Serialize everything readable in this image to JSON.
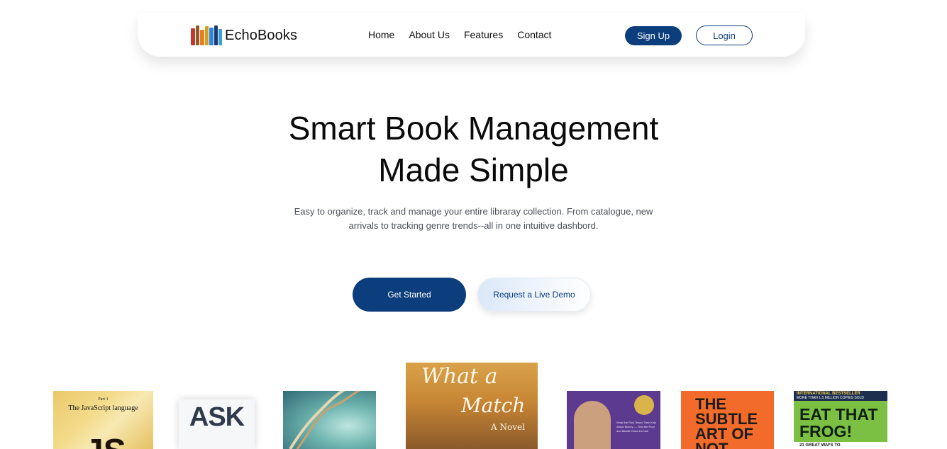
{
  "brand": {
    "name": "EchoBooks"
  },
  "nav": {
    "links": [
      "Home",
      "About Us",
      "Features",
      "Contact"
    ]
  },
  "auth": {
    "signup_label": "Sign Up",
    "login_label": "Login"
  },
  "hero": {
    "title_line1": "Smart Book Management",
    "title_line2": "Made Simple",
    "subtitle_line1": "Easy to organize, track and manage your entire libraray collection. From catalogue, new",
    "subtitle_line2": "arrivals to tracking genre trends--all in one intuitive dashbord.",
    "primary_cta": "Get Started",
    "secondary_cta": "Request a Live Demo"
  },
  "books": {
    "js": {
      "part": "Part 1",
      "subtitle": "The JavaScript language",
      "big": "JS"
    },
    "ask": {
      "title": "ASK"
    },
    "what_a_match": {
      "word1": "What a",
      "word2": "Match",
      "tag": "A Novel"
    },
    "rich_dad": {
      "blurb": "What the Rich Teach Their Kids About Money — That the Poor and Middle Class Do Not!"
    },
    "subtle_art": {
      "title": "THE SUBTLE ART OF NOT"
    },
    "eat_that_frog": {
      "banner": "INTERNATIONAL BESTSELLER",
      "banner_sub": "MORE THAN 1.5 MILLION COPIES SOLD",
      "title": "EAT THAT FROG!",
      "subtitle": "21 GREAT WAYS TO"
    }
  },
  "colors": {
    "primary": "#0c3d7c",
    "text": "#0a0a0a",
    "muted": "#4a4f57"
  }
}
